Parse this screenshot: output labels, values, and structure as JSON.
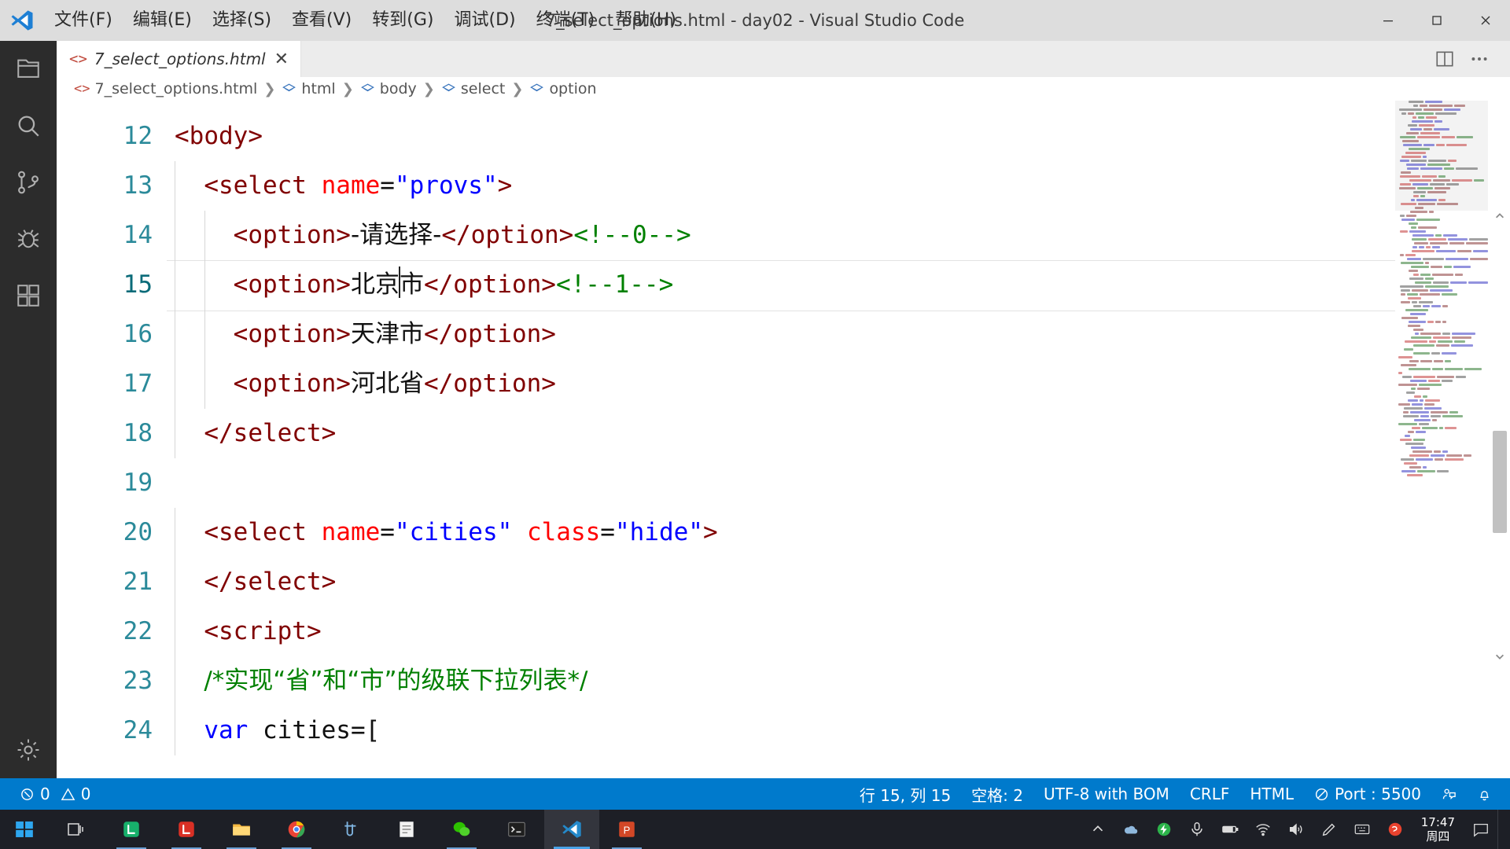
{
  "window": {
    "title": "7_select_options.html - day02 - Visual Studio Code",
    "minimize_label": "minimize",
    "maximize_label": "maximize",
    "close_label": "close"
  },
  "menubar": {
    "items": [
      {
        "label": "文件(F)",
        "name": "menu-file"
      },
      {
        "label": "编辑(E)",
        "name": "menu-edit"
      },
      {
        "label": "选择(S)",
        "name": "menu-selection"
      },
      {
        "label": "查看(V)",
        "name": "menu-view"
      },
      {
        "label": "转到(G)",
        "name": "menu-go"
      },
      {
        "label": "调试(D)",
        "name": "menu-debug"
      },
      {
        "label": "终端(T)",
        "name": "menu-terminal"
      },
      {
        "label": "帮助(H)",
        "name": "menu-help"
      }
    ]
  },
  "activitybar": {
    "items": [
      {
        "name": "explorer-icon",
        "label": "资源管理器"
      },
      {
        "name": "search-icon",
        "label": "搜索"
      },
      {
        "name": "source-control-icon",
        "label": "源代码管理"
      },
      {
        "name": "debug-icon",
        "label": "调试"
      },
      {
        "name": "extensions-icon",
        "label": "扩展"
      }
    ],
    "bottom": [
      {
        "name": "settings-gear-icon",
        "label": "管理"
      }
    ]
  },
  "tabs": [
    {
      "label": "7_select_options.html",
      "icon": "html-code-icon",
      "close": "✕",
      "preview": true,
      "active": true
    }
  ],
  "tab_actions": [
    {
      "name": "split-editor-icon"
    },
    {
      "name": "more-actions-icon"
    }
  ],
  "breadcrumb": {
    "segments": [
      {
        "label": "7_select_options.html",
        "icon": "html-code-icon"
      },
      {
        "label": "html",
        "icon": "symbol-tag-icon"
      },
      {
        "label": "body",
        "icon": "symbol-tag-icon"
      },
      {
        "label": "select",
        "icon": "symbol-tag-icon"
      },
      {
        "label": "option",
        "icon": "symbol-tag-icon"
      }
    ],
    "separator": "❯"
  },
  "editor": {
    "cursor_line": 15,
    "lines": [
      {
        "num": "12",
        "indent_guides": 0,
        "tokens": [
          {
            "t": "tag",
            "v": "<body>"
          }
        ]
      },
      {
        "num": "13",
        "indent_guides": 1,
        "tokens": [
          {
            "t": "plain",
            "v": "  "
          },
          {
            "t": "tag",
            "v": "<select "
          },
          {
            "t": "attr",
            "v": "name"
          },
          {
            "t": "plain",
            "v": "="
          },
          {
            "t": "val",
            "v": "\"provs\""
          },
          {
            "t": "tag",
            "v": ">"
          }
        ]
      },
      {
        "num": "14",
        "indent_guides": 2,
        "tokens": [
          {
            "t": "plain",
            "v": "    "
          },
          {
            "t": "tag",
            "v": "<option>"
          },
          {
            "t": "text",
            "v": "-请选择-"
          },
          {
            "t": "tag",
            "v": "</option>"
          },
          {
            "t": "cmt",
            "v": "<!--0-->"
          }
        ]
      },
      {
        "num": "15",
        "active": true,
        "indent_guides": 2,
        "tokens": [
          {
            "t": "plain",
            "v": "    "
          },
          {
            "t": "tag",
            "v": "<option>"
          },
          {
            "t": "text",
            "v": "北京"
          },
          {
            "t": "caret",
            "v": ""
          },
          {
            "t": "text",
            "v": "市"
          },
          {
            "t": "tag",
            "v": "</option>"
          },
          {
            "t": "cmt",
            "v": "<!--1-->"
          }
        ]
      },
      {
        "num": "16",
        "indent_guides": 2,
        "tokens": [
          {
            "t": "plain",
            "v": "    "
          },
          {
            "t": "tag",
            "v": "<option>"
          },
          {
            "t": "text",
            "v": "天津市"
          },
          {
            "t": "tag",
            "v": "</option>"
          }
        ]
      },
      {
        "num": "17",
        "indent_guides": 2,
        "tokens": [
          {
            "t": "plain",
            "v": "    "
          },
          {
            "t": "tag",
            "v": "<option>"
          },
          {
            "t": "text",
            "v": "河北省"
          },
          {
            "t": "tag",
            "v": "</option>"
          }
        ]
      },
      {
        "num": "18",
        "indent_guides": 1,
        "tokens": [
          {
            "t": "plain",
            "v": "  "
          },
          {
            "t": "tag",
            "v": "</select>"
          }
        ]
      },
      {
        "num": "19",
        "indent_guides": 0,
        "tokens": [
          {
            "t": "plain",
            "v": ""
          }
        ]
      },
      {
        "num": "20",
        "indent_guides": 1,
        "tokens": [
          {
            "t": "plain",
            "v": "  "
          },
          {
            "t": "tag",
            "v": "<select "
          },
          {
            "t": "attr",
            "v": "name"
          },
          {
            "t": "plain",
            "v": "="
          },
          {
            "t": "val",
            "v": "\"cities\""
          },
          {
            "t": "plain",
            "v": " "
          },
          {
            "t": "attr",
            "v": "class"
          },
          {
            "t": "plain",
            "v": "="
          },
          {
            "t": "val",
            "v": "\"hide\""
          },
          {
            "t": "tag",
            "v": ">"
          }
        ]
      },
      {
        "num": "21",
        "indent_guides": 1,
        "tokens": [
          {
            "t": "plain",
            "v": "  "
          },
          {
            "t": "tag",
            "v": "</select>"
          }
        ]
      },
      {
        "num": "22",
        "indent_guides": 1,
        "tokens": [
          {
            "t": "plain",
            "v": "  "
          },
          {
            "t": "tag",
            "v": "<script>"
          }
        ]
      },
      {
        "num": "23",
        "indent_guides": 1,
        "tokens": [
          {
            "t": "plain",
            "v": "  "
          },
          {
            "t": "cmt",
            "v": "/*实现“省”和“市”的级联下拉列表*/"
          }
        ]
      },
      {
        "num": "24",
        "indent_guides": 1,
        "tokens": [
          {
            "t": "plain",
            "v": "  "
          },
          {
            "t": "kw",
            "v": "var"
          },
          {
            "t": "plain",
            "v": " cities=["
          }
        ]
      }
    ]
  },
  "statusbar": {
    "left": [
      {
        "name": "error-count",
        "icon": "error-circle-icon",
        "label": "0"
      },
      {
        "name": "warning-count",
        "icon": "warning-triangle-icon",
        "label": "0"
      }
    ],
    "right": [
      {
        "name": "cursor-position",
        "label": "行 15, 列 15"
      },
      {
        "name": "indentation",
        "label": "空格: 2"
      },
      {
        "name": "encoding",
        "label": "UTF-8 with BOM"
      },
      {
        "name": "eol",
        "label": "CRLF"
      },
      {
        "name": "language-mode",
        "label": "HTML"
      },
      {
        "name": "live-server-port",
        "icon": "no-entry-icon",
        "label": "Port : 5500"
      },
      {
        "name": "feedback-icon",
        "label": ""
      },
      {
        "name": "notifications-bell-icon",
        "label": ""
      }
    ]
  },
  "taskbar": {
    "start": {
      "name": "windows-start-button"
    },
    "search": {
      "name": "task-view-button"
    },
    "apps": [
      {
        "name": "taskbar-app-lanxin-green",
        "color": "#17b06b",
        "state": "open"
      },
      {
        "name": "taskbar-app-lanxin-red",
        "color": "#d93025",
        "state": "open"
      },
      {
        "name": "taskbar-app-file-explorer",
        "color": "#f5b841",
        "state": "open"
      },
      {
        "name": "taskbar-app-chrome",
        "color": "#4285f4",
        "state": "open"
      },
      {
        "name": "taskbar-app-snipaste",
        "color": "#3d7ebf",
        "state": "none"
      },
      {
        "name": "taskbar-app-notepad",
        "color": "#6b6b6b",
        "state": "none"
      },
      {
        "name": "taskbar-app-wechat",
        "color": "#2dc100",
        "state": "open"
      },
      {
        "name": "taskbar-app-terminal",
        "color": "#1f1f1f",
        "state": "none"
      },
      {
        "name": "taskbar-app-vscode",
        "color": "#2489ca",
        "state": "active"
      },
      {
        "name": "taskbar-app-powerpoint",
        "color": "#d24726",
        "state": "open"
      }
    ],
    "tray": [
      {
        "name": "tray-expand-chevron-icon"
      },
      {
        "name": "tray-onedrive-icon"
      },
      {
        "name": "tray-thunder-icon"
      },
      {
        "name": "tray-microphone-icon"
      },
      {
        "name": "tray-battery-icon"
      },
      {
        "name": "tray-network-icon"
      },
      {
        "name": "tray-volume-icon"
      },
      {
        "name": "tray-pen-icon"
      },
      {
        "name": "tray-ime-icon"
      },
      {
        "name": "tray-sogou-icon"
      }
    ],
    "clock": {
      "time": "17:47",
      "date": "周四"
    },
    "notification": {
      "name": "action-center-icon"
    }
  }
}
